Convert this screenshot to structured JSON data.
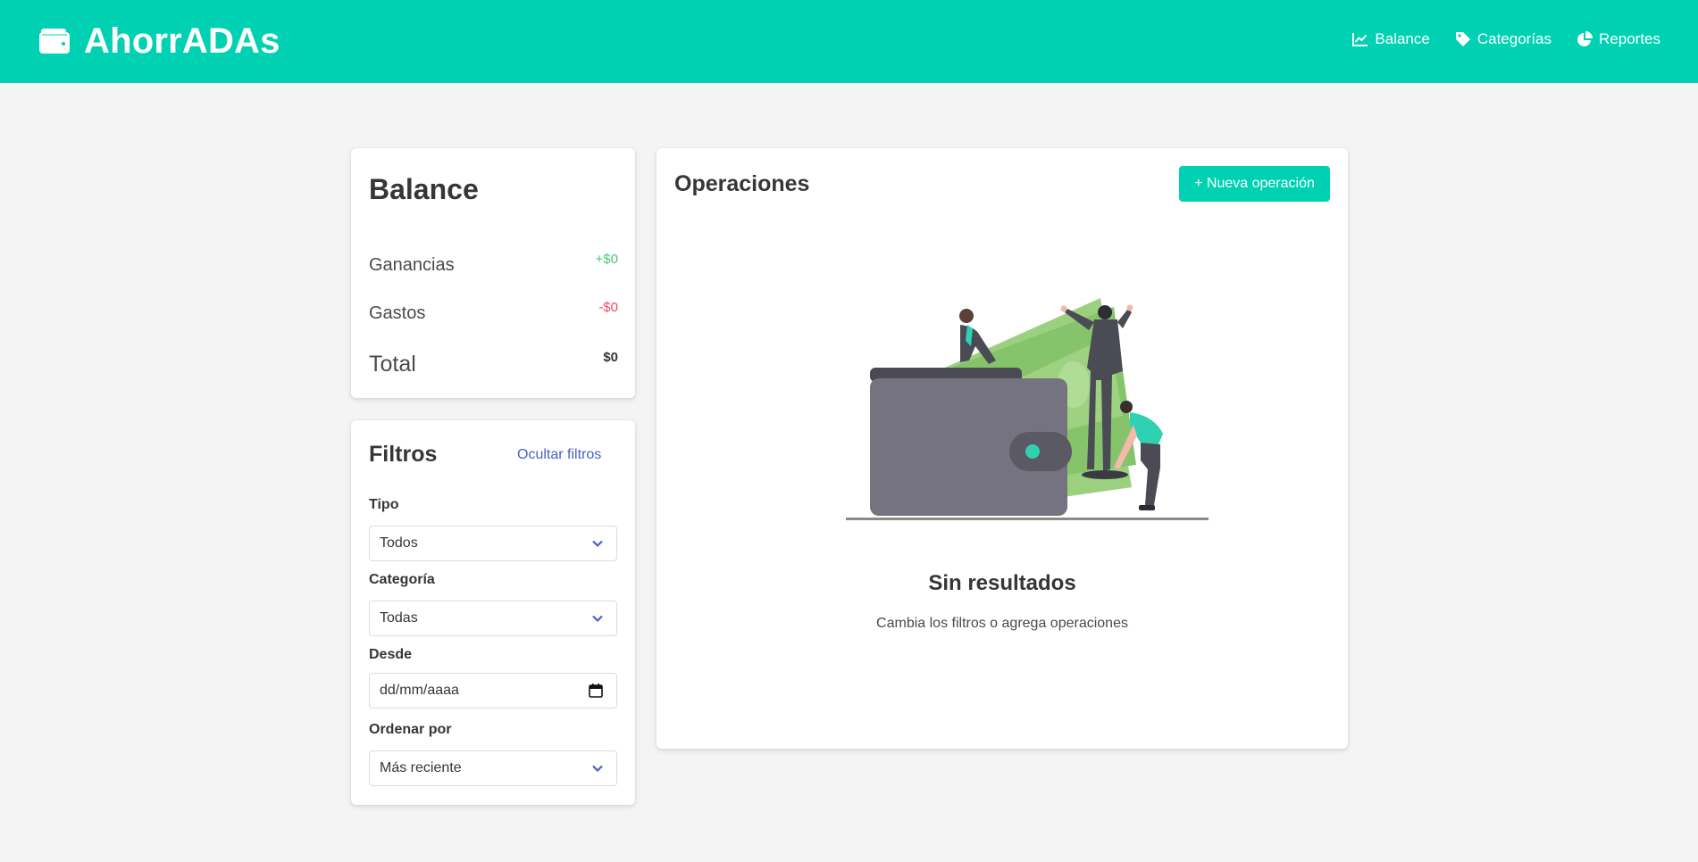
{
  "app": {
    "name": "AhorrADAs",
    "logo_icon": "wallet-icon",
    "brand_color": "#00d1b2"
  },
  "nav": {
    "items": [
      {
        "label": "Balance",
        "icon": "chart-line-icon"
      },
      {
        "label": "Categorías",
        "icon": "tag-icon"
      },
      {
        "label": "Reportes",
        "icon": "pie-chart-icon"
      }
    ]
  },
  "balance": {
    "title": "Balance",
    "rows": [
      {
        "label": "Ganancias",
        "value": "+$0",
        "color": "#48c774"
      },
      {
        "label": "Gastos",
        "value": "-$0",
        "color": "#f14668"
      }
    ],
    "total": {
      "label": "Total",
      "value": "$0"
    }
  },
  "filters": {
    "title": "Filtros",
    "toggle_label": "Ocultar filtros",
    "tipo": {
      "label": "Tipo",
      "value": "Todos"
    },
    "categoria": {
      "label": "Categoría",
      "value": "Todas"
    },
    "desde": {
      "label": "Desde",
      "placeholder": "dd/mm/aaaa"
    },
    "ordenar": {
      "label": "Ordenar por",
      "value": "Más reciente"
    }
  },
  "operations": {
    "title": "Operaciones",
    "new_button": "+ Nueva operación",
    "empty_title": "Sin resultados",
    "empty_subtitle": "Cambia los filtros o agrega operaciones"
  }
}
